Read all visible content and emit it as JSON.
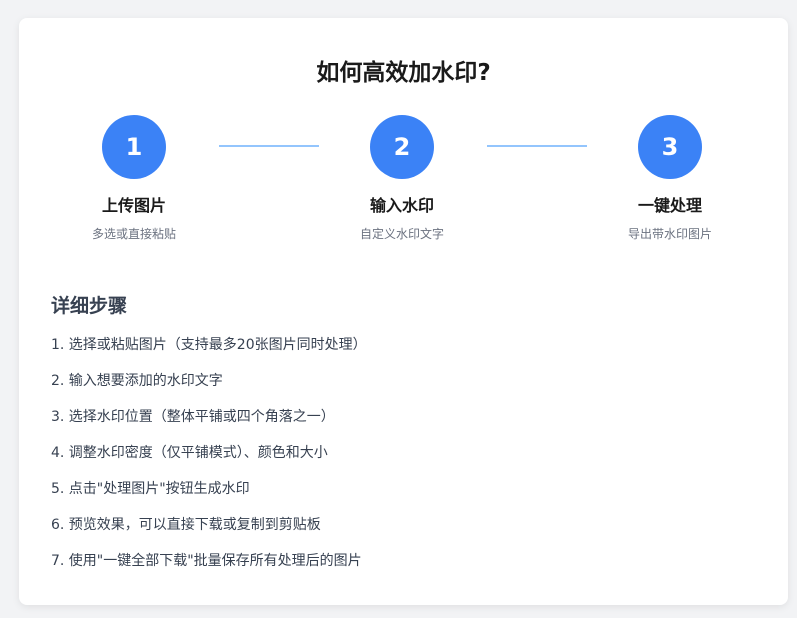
{
  "title": "如何高效加水印?",
  "steps": [
    {
      "number": "1",
      "title": "上传图片",
      "desc": "多选或直接粘贴"
    },
    {
      "number": "2",
      "title": "输入水印",
      "desc": "自定义水印文字"
    },
    {
      "number": "3",
      "title": "一键处理",
      "desc": "导出带水印图片"
    }
  ],
  "details": {
    "title": "详细步骤",
    "items": [
      "1. 选择或粘贴图片（支持最多20张图片同时处理）",
      "2. 输入想要添加的水印文字",
      "3. 选择水印位置（整体平铺或四个角落之一）",
      "4. 调整水印密度（仅平铺模式）、颜色和大小",
      "5. 点击\"处理图片\"按钮生成水印",
      "6. 预览效果，可以直接下载或复制到剪贴板",
      "7. 使用\"一键全部下载\"批量保存所有处理后的图片"
    ]
  },
  "colors": {
    "accent": "#3b82f6",
    "connector": "#93c5fd",
    "background": "#f2f3f5"
  }
}
